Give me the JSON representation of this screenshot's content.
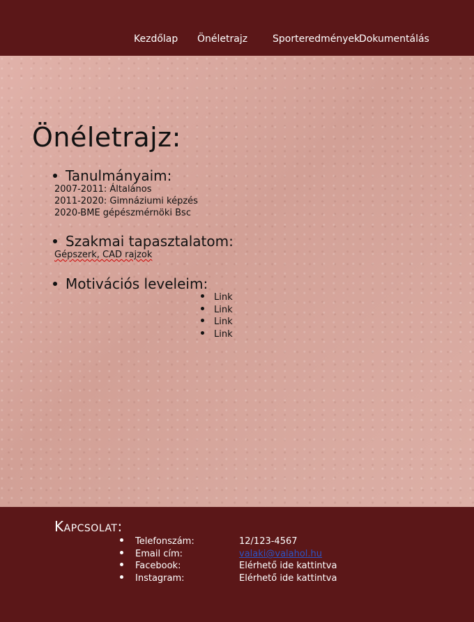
{
  "nav": {
    "items": [
      "Kezdőlap",
      "Önéletrajz",
      "Sporteredmények",
      "Dokumentálás"
    ]
  },
  "main": {
    "title": "Önéletrajz:",
    "sections": [
      {
        "heading": "Tanulmányaim:",
        "lines": [
          "2007-2011: Általános",
          "2011-2020: Gimnáziumi képzés",
          "2020-BME gépészmérnöki Bsc"
        ]
      },
      {
        "heading": "Szakmai tapasztalatom:",
        "lines": [
          "Gépszerk, CAD rajzok"
        ]
      },
      {
        "heading": "Motivációs leveleim:",
        "links": [
          "Link",
          "Link",
          "Link",
          "Link"
        ]
      }
    ]
  },
  "footer": {
    "title": "Kapcsolat:",
    "contacts": [
      {
        "label": "Telefonszám:",
        "value": "12/123-4567"
      },
      {
        "label": "Email cím:",
        "value": "valaki@valahol.hu"
      },
      {
        "label": "Facebook:",
        "value": "Elérhető ide kattintva"
      },
      {
        "label": "Instagram:",
        "value": "Elérhető ide kattintva"
      }
    ]
  },
  "colors": {
    "header_footer_bg": "#5b1718",
    "page_bg": "#d7a89f",
    "link": "#2b54c6"
  }
}
